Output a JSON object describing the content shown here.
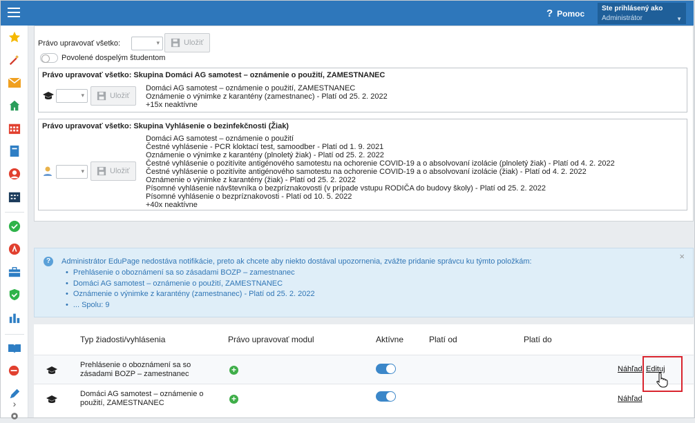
{
  "topbar": {
    "help_label": "Pomoc",
    "user_label": "Ste prihlásený ako",
    "user_role": "Administrátor"
  },
  "sidebar": {
    "icons": [
      "star-icon",
      "magic-wand-icon",
      "mail-icon",
      "home-icon",
      "calendar-icon",
      "book-icon",
      "person-icon",
      "timetable-icon",
      "check-circle-icon",
      "alert-icon",
      "briefcase-icon",
      "shield-icon",
      "bar-chart-icon",
      "open-book-icon",
      "chat-icon",
      "pencil-icon",
      "settings-icon"
    ]
  },
  "rights": {
    "label": "Právo upravovať všetko:",
    "save_label": "Uložiť",
    "adult_label": "Povolené dospelým študentom"
  },
  "groups": [
    {
      "title": "Právo upravovať všetko: Skupina Domáci AG samotest – oznámenie o použití, ZAMESTNANEC",
      "icon": "graduation-cap-icon",
      "save_label": "Uložiť",
      "items": [
        "Domáci AG samotest – oznámenie o použití, ZAMESTNANEC",
        "Oznámenie o výnimke z karantény (zamestnanec) - Platí od 25. 2. 2022",
        "+15x neaktívne"
      ]
    },
    {
      "title": "Právo upravovať všetko: Skupina Vyhlásenie o bezinfekčnosti (Žiak)",
      "icon": "student-icon",
      "save_label": "Uložiť",
      "items": [
        "Domáci AG samotest – oznámenie o použití",
        "Čestné vyhlásenie - PCR kloktací test, samoodber - Platí od 1. 9. 2021",
        "Oznámenie o výnimke z karantény (plnoletý žiak) - Platí od 25. 2. 2022",
        "Čestné vyhlásenie o pozitívite antigénového samotestu na ochorenie COVID-19 a o absolvovaní izolácie (plnoletý žiak) - Platí od 4. 2. 2022",
        "Čestné vyhlásenie o pozitívite antigénového samotestu na ochorenie COVID-19 a o absolvovaní izolácie (žiak) - Platí od 4. 2. 2022",
        "Oznámenie o výnimke z karantény (žiak) - Platí od 25. 2. 2022",
        "Písomné vyhlásenie návštevníka o bezpríznakovosti (v prípade vstupu RODIČA do budovy školy) - Platí od 25. 2. 2022",
        "Písomné vyhlásenie o bezpríznakovosti - Platí od 10. 5. 2022",
        "+40x neaktívne"
      ]
    }
  ],
  "info": {
    "text": "Administrátor EduPage nedostáva notifikácie, preto ak chcete aby niekto dostával upozornenia, zvážte pridanie správcu ku týmto položkám:",
    "items": [
      "Prehlásenie o oboznámení sa so zásadami BOZP – zamestnanec",
      "Domáci AG samotest – oznámenie o použití, ZAMESTNANEC",
      "Oznámenie o výnimke z karantény (zamestnanec) - Platí od 25. 2. 2022",
      "... Spolu: 9"
    ],
    "close": "×"
  },
  "table": {
    "headers": [
      "Typ žiadosti/vyhlásenia",
      "Právo upravovať modul",
      "Aktívne",
      "Platí od",
      "Platí do"
    ],
    "rows": [
      {
        "name_l1": "Prehlásenie o oboznámení sa so",
        "name_l2": "zásadami BOZP – zamestnanec",
        "active": true,
        "preview": "Náhľad",
        "edit": "Edituj"
      },
      {
        "name_l1": "Domáci AG samotest – oznámenie o",
        "name_l2": "použití, ZAMESTNANEC",
        "active": true,
        "preview": "Náhľad"
      }
    ]
  }
}
